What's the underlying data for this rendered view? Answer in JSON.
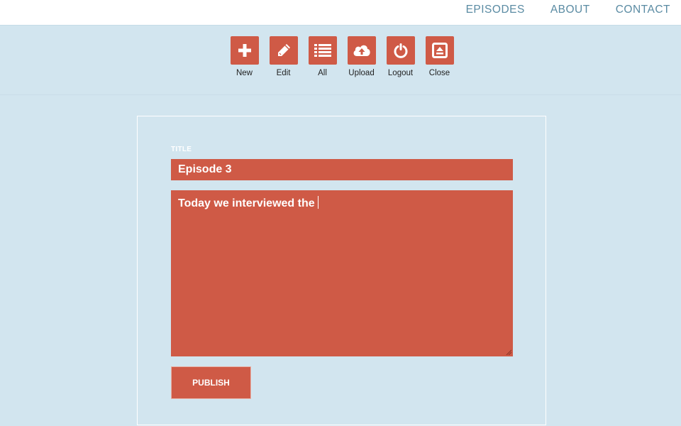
{
  "nav": {
    "items": [
      {
        "label": "EPISODES"
      },
      {
        "label": "ABOUT"
      },
      {
        "label": "CONTACT"
      }
    ]
  },
  "toolbar": {
    "items": [
      {
        "label": "New",
        "icon": "plus-icon"
      },
      {
        "label": "Edit",
        "icon": "pencil-icon"
      },
      {
        "label": "All",
        "icon": "list-icon"
      },
      {
        "label": "Upload",
        "icon": "cloud-upload-icon"
      },
      {
        "label": "Logout",
        "icon": "power-icon"
      },
      {
        "label": "Close",
        "icon": "eject-icon"
      }
    ]
  },
  "form": {
    "title_label": "TITLE",
    "title_value": "Episode 3",
    "body_value": "Today we interviewed the",
    "publish_label": "PUBLISH"
  },
  "colors": {
    "accent": "#cf5a46",
    "background": "#d2e5ef",
    "nav_text": "#5a8ba3"
  }
}
